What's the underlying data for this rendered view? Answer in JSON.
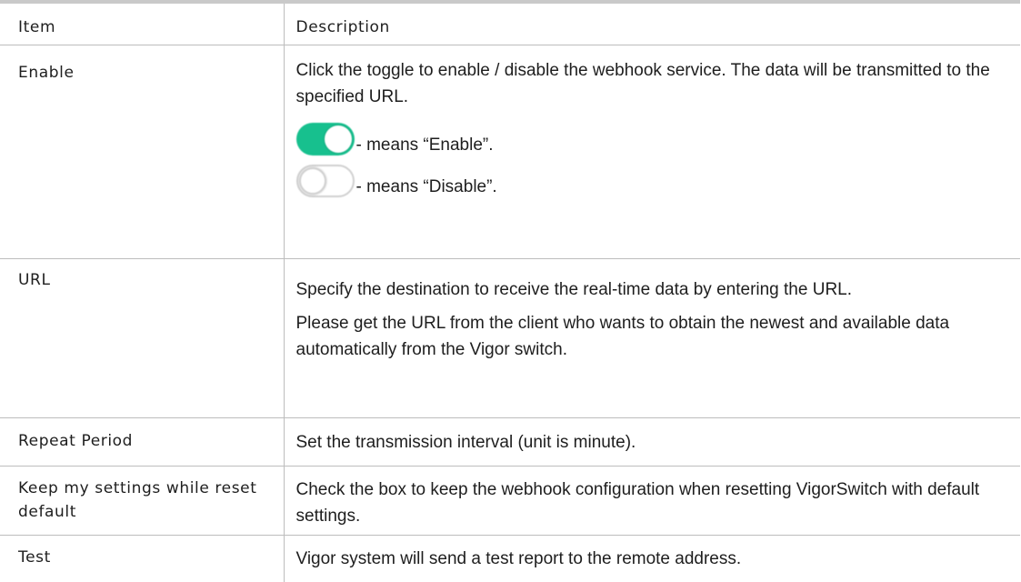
{
  "header": {
    "item": "Item",
    "description": "Description"
  },
  "rows": [
    {
      "item": "Enable",
      "description": "Click the toggle to enable / disable the webhook service. The data will be transmitted to the specified URL.",
      "toggles": [
        {
          "state": "on",
          "color": "#17c08e",
          "text": "- means “Enable”."
        },
        {
          "state": "off",
          "color": "#d0d0d0",
          "text": "- means “Disable”."
        }
      ]
    },
    {
      "item": "URL",
      "paragraphs": [
        "Specify the destination to receive the real-time data by entering the URL.",
        "Please get the URL from the client who wants to obtain the newest and available data automatically from the Vigor switch."
      ]
    },
    {
      "item": "Repeat Period",
      "description": "Set the transmission interval (unit is minute)."
    },
    {
      "item": "Keep my settings while reset default",
      "description": "Check the box to keep the webhook configuration when resetting VigorSwitch with default settings."
    },
    {
      "item": "Test",
      "description": "Vigor system will send a test report to the remote address."
    }
  ]
}
